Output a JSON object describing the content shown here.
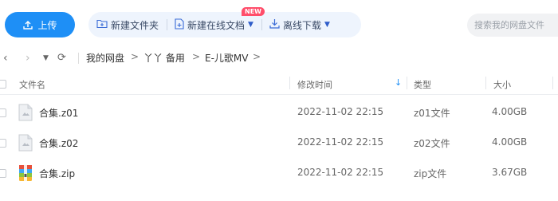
{
  "toolbar": {
    "upload_label": "上传",
    "new_folder_label": "新建文件夹",
    "new_online_doc_label": "新建在线文档",
    "new_badge": "NEW",
    "offline_download_label": "离线下载",
    "search_placeholder": "搜索我的网盘文件"
  },
  "breadcrumb": {
    "items": [
      "我的网盘",
      "丫丫 备用",
      "E-儿歌MV"
    ],
    "separator": ">"
  },
  "table": {
    "columns": {
      "name": "文件名",
      "modified": "修改时间",
      "type": "类型",
      "size": "大小"
    },
    "sort_icon": "sort-down-arrow-icon",
    "rows": [
      {
        "name": "合集.z01",
        "modified": "2022-11-02 22:15",
        "type": "z01文件",
        "size": "4.00GB",
        "icon": "generic-file-icon"
      },
      {
        "name": "合集.z02",
        "modified": "2022-11-02 22:15",
        "type": "z02文件",
        "size": "4.00GB",
        "icon": "generic-file-icon"
      },
      {
        "name": "合集.zip",
        "modified": "2022-11-02 22:15",
        "type": "zip文件",
        "size": "3.67GB",
        "icon": "zip-archive-icon"
      }
    ]
  },
  "colors": {
    "accent": "#1e8ff6",
    "toolbar_group_bg": "#eef4fd",
    "badge": "#ff4d6a"
  }
}
